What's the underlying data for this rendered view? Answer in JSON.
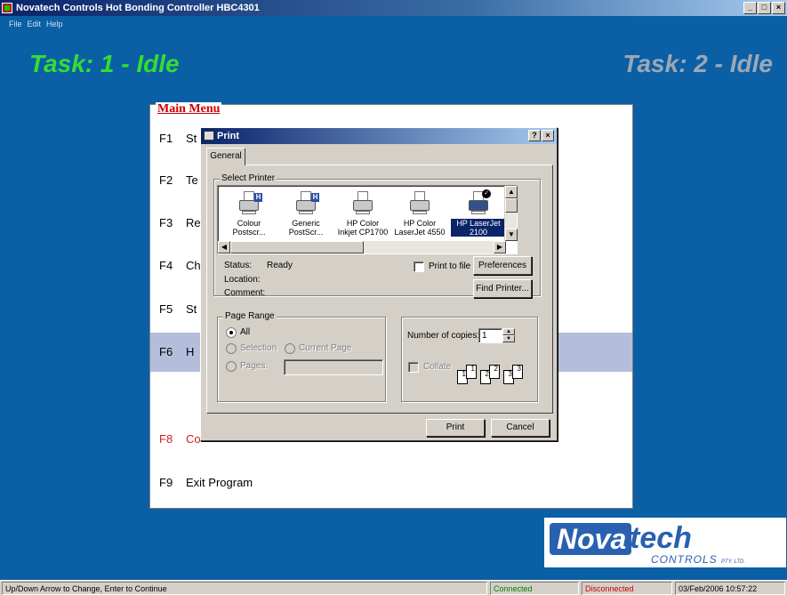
{
  "window": {
    "title": "Novatech Controls Hot Bonding Controller HBC4301",
    "minimize": "_",
    "maximize": "□",
    "close": "×"
  },
  "menubar": [
    "File",
    "Edit",
    "Help"
  ],
  "tasks": {
    "task1": "Task: 1 - Idle",
    "task2": "Task: 2 - Idle",
    "task1_color": "#33dd33",
    "task2_color": "#9ba8b5"
  },
  "main_menu": {
    "title": "Main Menu",
    "items": [
      {
        "key": "F1",
        "label": "St"
      },
      {
        "key": "F2",
        "label": "Te"
      },
      {
        "key": "F3",
        "label": "Re"
      },
      {
        "key": "F4",
        "label": "Ch"
      },
      {
        "key": "F5",
        "label": "St"
      },
      {
        "key": "F6",
        "label": "H"
      },
      {
        "key": "F8",
        "label": "Co"
      },
      {
        "key": "F9",
        "label": "Exit Program"
      }
    ]
  },
  "print_dialog": {
    "title": "Print",
    "help": "?",
    "close": "×",
    "tab": "General",
    "select_printer_label": "Select Printer",
    "printers": [
      {
        "line1": "Colour",
        "line2": "Postscr..."
      },
      {
        "line1": "Generic",
        "line2": "PostScr..."
      },
      {
        "line1": "HP Color",
        "line2": "Inkjet CP1700"
      },
      {
        "line1": "HP Color",
        "line2": "LaserJet 4550"
      },
      {
        "line1": "HP LaserJet",
        "line2": "2100"
      }
    ],
    "status_label": "Status:",
    "status_value": "Ready",
    "location_label": "Location:",
    "comment_label": "Comment:",
    "print_to_file": "Print to file",
    "preferences": "Preferences",
    "find_printer": "Find Printer...",
    "page_range_label": "Page Range",
    "range_all": "All",
    "range_selection": "Selection",
    "range_current_page": "Current Page",
    "range_pages": "Pages:",
    "copies_label": "Number of copies:",
    "copies_value": "1",
    "collate": "Collate",
    "collate_pages": [
      "1",
      "1",
      "2",
      "2",
      "3",
      "3"
    ],
    "print_button": "Print",
    "cancel_button": "Cancel"
  },
  "logo": {
    "nova": "Nova",
    "tech": "tech",
    "controls": "CONTROLS",
    "pty": "PTY. LTD."
  },
  "statusbar": {
    "hint": "Up/Down Arrow to Change, Enter to Continue",
    "connected": "Connected",
    "disconnected": "Disconnected",
    "datetime": "03/Feb/2006  10:57:22",
    "connected_color": "#008000",
    "disconnected_color": "#cc0000"
  }
}
